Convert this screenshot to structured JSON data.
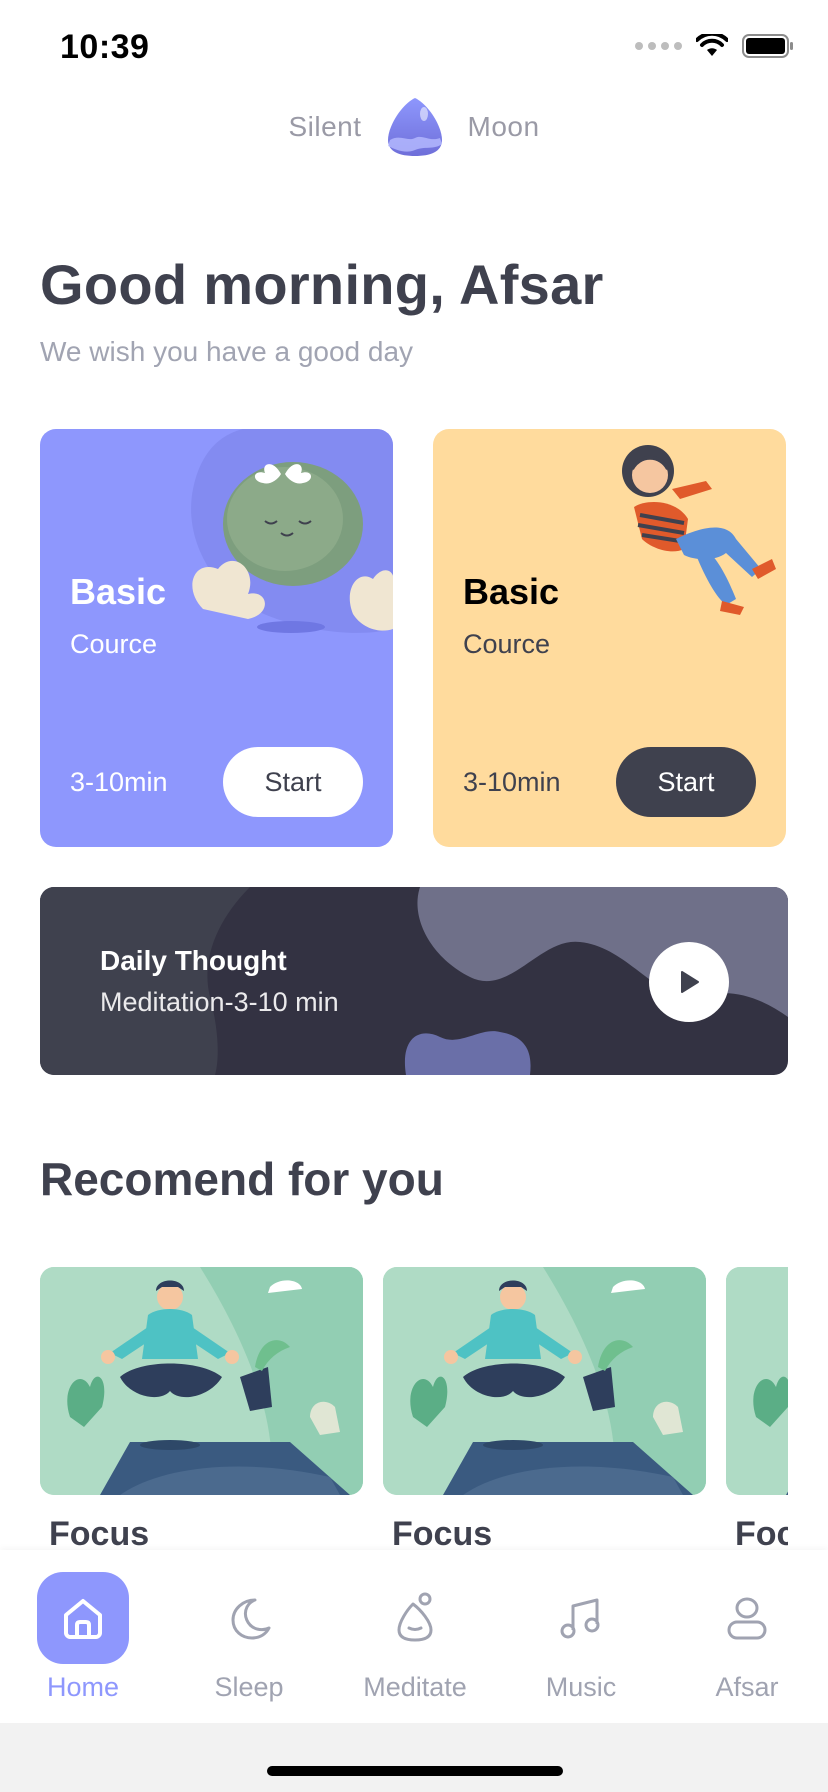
{
  "status_bar": {
    "time": "10:39"
  },
  "brand": {
    "left": "Silent",
    "right": "Moon",
    "logo_icon": "silent-moon-logo-icon"
  },
  "greeting": {
    "title": "Good morning, Afsar",
    "subtitle": "We wish you have a good day"
  },
  "courses": [
    {
      "title": "Basic",
      "subtitle": "Cource",
      "duration": "3-10min",
      "button": "Start",
      "color": "#8E97FD"
    },
    {
      "title": "Basic",
      "subtitle": "Cource",
      "duration": "3-10min",
      "button": "Start",
      "color": "#FFDB9D"
    }
  ],
  "daily": {
    "title": "Daily Thought",
    "subtitle": "Meditation-3-10 min",
    "icon": "play-icon"
  },
  "recommend": {
    "title": "Recomend for you",
    "items": [
      {
        "label": "Focus"
      },
      {
        "label": "Focus"
      },
      {
        "label": "Focus"
      }
    ]
  },
  "nav": {
    "items": [
      {
        "label": "Home",
        "icon": "home-icon",
        "active": true
      },
      {
        "label": "Sleep",
        "icon": "moon-icon"
      },
      {
        "label": "Meditate",
        "icon": "meditate-icon"
      },
      {
        "label": "Music",
        "icon": "music-icon"
      },
      {
        "label": "Afsar",
        "icon": "user-icon"
      }
    ]
  },
  "colors": {
    "accent": "#8E97FD",
    "dark": "#3F414E",
    "yellow": "#FFDB9D"
  }
}
